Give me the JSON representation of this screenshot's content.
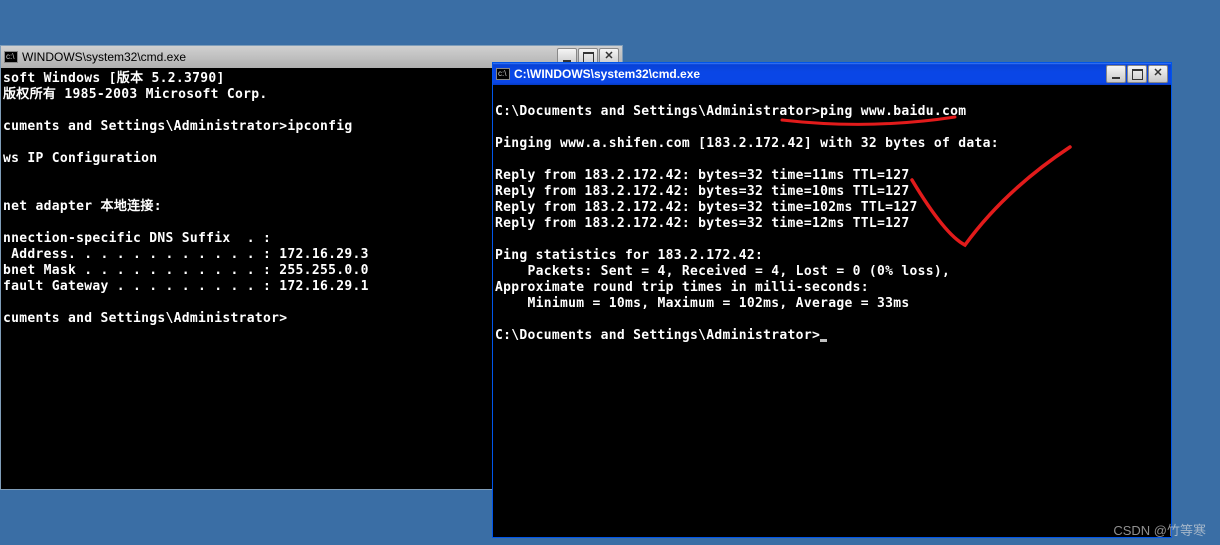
{
  "win1": {
    "title": "WINDOWS\\system32\\cmd.exe",
    "lines": [
      "soft Windows [版本 5.2.3790]",
      "版权所有 1985-2003 Microsoft Corp.",
      "",
      "cuments and Settings\\Administrator>ipconfig",
      "",
      "ws IP Configuration",
      "",
      "",
      "net adapter 本地连接:",
      "",
      "nnection-specific DNS Suffix  . :",
      " Address. . . . . . . . . . . . : 172.16.29.3",
      "bnet Mask . . . . . . . . . . . : 255.255.0.0",
      "fault Gateway . . . . . . . . . : 172.16.29.1",
      "",
      "cuments and Settings\\Administrator>"
    ]
  },
  "win2": {
    "title": "C:\\WINDOWS\\system32\\cmd.exe",
    "lines": [
      "",
      "C:\\Documents and Settings\\Administrator>ping www.baidu.com",
      "",
      "Pinging www.a.shifen.com [183.2.172.42] with 32 bytes of data:",
      "",
      "Reply from 183.2.172.42: bytes=32 time=11ms TTL=127",
      "Reply from 183.2.172.42: bytes=32 time=10ms TTL=127",
      "Reply from 183.2.172.42: bytes=32 time=102ms TTL=127",
      "Reply from 183.2.172.42: bytes=32 time=12ms TTL=127",
      "",
      "Ping statistics for 183.2.172.42:",
      "    Packets: Sent = 4, Received = 4, Lost = 0 (0% loss),",
      "Approximate round trip times in milli-seconds:",
      "    Minimum = 10ms, Maximum = 102ms, Average = 33ms",
      "",
      "C:\\Documents and Settings\\Administrator>"
    ]
  },
  "watermark": "CSDN @竹等寒"
}
